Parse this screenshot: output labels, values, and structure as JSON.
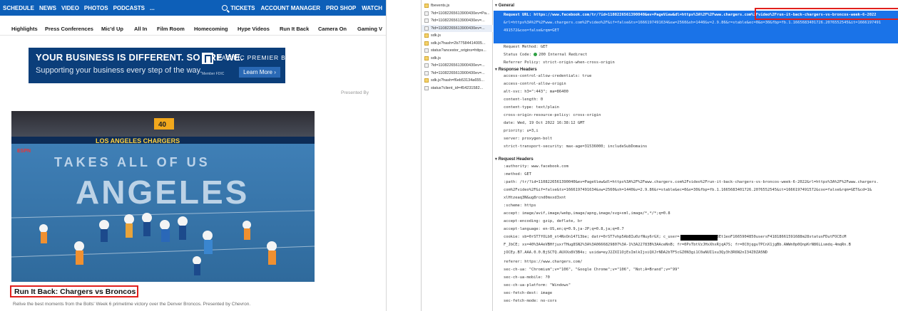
{
  "site": {
    "topnav_left": [
      "SCHEDULE",
      "NEWS",
      "VIDEO",
      "PHOTOS",
      "PODCASTS",
      "..."
    ],
    "topnav_right": [
      "TICKETS",
      "ACCOUNT MANAGER",
      "PRO SHOP",
      "WATCH"
    ],
    "subnav": [
      "Highlights",
      "Press Conferences",
      "Mic'd Up",
      "All In",
      "Film Room",
      "Homecoming",
      "Hype Videos",
      "Run It Back",
      "Camera On",
      "Gaming V"
    ],
    "ad": {
      "headline": "YOUR BUSINESS IS DIFFERENT. SO ARE WE.",
      "subline": "Supporting your business every step of the way.",
      "brand": "PACIFIC PREMIER BANK",
      "member": "Member FDIC",
      "cta": "Learn More ›"
    },
    "presented_by": "Presented By",
    "video": {
      "stadium_banner": "LOS ANGELES CHARGERS",
      "field_text": "TAKES ALL OF US",
      "field_logo": "ANGELES",
      "scoreboard": "40",
      "network": "ESPN"
    },
    "video_title": "Run It Back: Chargers vs Broncos",
    "video_desc": "Relive the best moments from the Bolts' Week 6 primetime victory over the Denver Broncos. Presented by Chevron."
  },
  "devtools": {
    "requests": [
      {
        "name": "fbevents.js",
        "type": "js"
      },
      {
        "name": "?id=11082265613900430ev=Pa...",
        "type": "doc"
      },
      {
        "name": "?id=11082265613900430ev=...",
        "type": "doc"
      },
      {
        "name": "?id=11082265613900430ev=...",
        "type": "doc"
      },
      {
        "name": "sdk.js",
        "type": "js"
      },
      {
        "name": "sdk.js?hash=2b77584414005...",
        "type": "js"
      },
      {
        "name": "status?ancestor_origins=https...",
        "type": "doc"
      },
      {
        "name": "sdk.js",
        "type": "js"
      },
      {
        "name": "?id=11082265613900430ev=...",
        "type": "doc"
      },
      {
        "name": "?id=11082265613900430ev=...",
        "type": "doc"
      },
      {
        "name": "sdk.js?hash=f6eb53134a655...",
        "type": "js"
      },
      {
        "name": "status?client_id=454231582...",
        "type": "doc"
      }
    ],
    "general_title": "General",
    "request_url_label": "Request URL:",
    "request_url_1": "https://www.facebook.com/tr/?id=1108226561390040&ev=PageView&dl=https%3A%2F%2Fwww.chargers.com%2Fvideo%2Frun-it-back-chargers-vs-broncos-week-6-2022",
    "request_url_2": "&rl=https%3A%2F%2Fwww.chargers.com%2Fvideo%2F&if=false&ts=1666197491634&sw=2560&sh=1440&v=2.9.86&r=stable&ec=0&o=30&fbp=fb.1.1665683401726.2076552545&it=1666197491",
    "request_url_3": "491572&coo=false&rqm=GET",
    "request_method": "Request Method: GET",
    "status_code_label": "Status Code:",
    "status_code": "200 Internal Redirect",
    "referrer_policy": "Referrer Policy: strict-origin-when-cross-origin",
    "response_headers_title": "Response Headers",
    "response_headers": [
      "access-control-allow-credentials: true",
      "access-control-allow-origin",
      "alt-svc: h3=\":443\"; ma=86400",
      "content-length: 0",
      "content-type: text/plain",
      "cross-origin-resource-policy: cross-origin",
      "date: Wed, 19 Oct 2022 16:38:12 GMT",
      "priority: u=3,i",
      "server: proxygen-bolt",
      "strict-transport-security: max-age=31536000; includeSubDomains"
    ],
    "request_headers_title": "Request Headers",
    "request_headers": [
      ":authority: www.facebook.com",
      ":method: GET",
      ":path: /tr/?id=1108226561390040&ev=PageView&dl=https%3A%2F%2Fwww.chargers.com%2Fvideo%2Frun-it-back-chargers-vs-broncos-week-6-2022&rl=https%3A%2F%2Fwww.chargers.",
      "com%2Fvideo%2F&if=false&ts=1666197491634&sw=2560&sh=1440&v=2.9.86&r=stable&ec=0&o=30&fbp=fb.1.1665683401726.2076552545&it=1666197491572&coo=false&rqm=GET&cd=1&",
      "xlHtzeaq3N&ug8rcnd0mxxd3xnt",
      ":scheme: https",
      "accept: image/avif,image/webp,image/apng,image/svg+xml,image/*,*/*;q=0.8",
      "accept-encoding: gzip, deflate, br",
      "accept-language: en-US,en;q=0.9,ja-JP;q=0.8,ja;q=0.7",
      "cookie: sb=0rST7fOLb0_st4NxOn14713be; datr=0rST7vhp5Ab8Iu0zfNuy6rGX; c_user=          ; presence=EDvF3Et1eoF1665904850usersF41818661591688m28statusFDutFOCEcM",
      "F_JbCE; xs=40%3A4eVBHfjuxrTHug8SN2%3A%3A0666829807%3A-1%3A22783B%3AAceNnB; fr=0PxTbtVzJHxXhxRjqA7S; fr=0C0jqgv7PCnX1jgBb.AWWn0p0QnpKrN86LLsmdq-4mqRn.B",
      "jOCEy.B7.AAA.0.0.BjSCTQ.AUXXo8V3B4s; usida=eyJ2ZXI1OjEsImlkIjoiQXJrNDA2bTF5cGZ0N3gi1C0aNUI1xu3Qy3h3R6N2nI34Z0ZA5ND",
      "referer: https://www.chargers.com/",
      "sec-ch-ua: \"Chromium\";v=\"106\", \"Google Chrome\";v=\"106\", \"Not;A=Brand\";v=\"99\"",
      "sec-ch-ua-mobile: ?0",
      "sec-ch-ua-platform: \"Windows\"",
      "sec-fetch-dest: image",
      "sec-fetch-mode: no-cors"
    ]
  }
}
